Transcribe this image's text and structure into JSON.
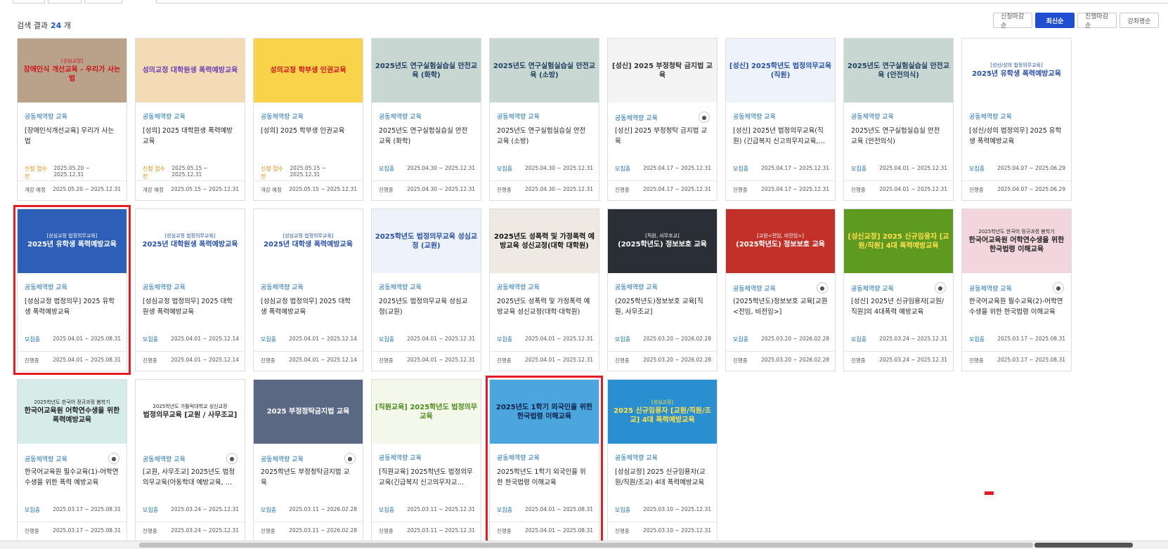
{
  "results": {
    "label": "검색 결과",
    "count": "24",
    "unit": "개"
  },
  "sort_buttons": [
    {
      "label": "신청마감순",
      "active": false
    },
    {
      "label": "최신순",
      "active": true
    },
    {
      "label": "진행마감순",
      "active": false
    },
    {
      "label": "강좌명순",
      "active": false
    }
  ],
  "cards": [
    {
      "thumb": "장애인식 개선교육 - 우리가 사는 법",
      "thumb_sub": "[성심교정]",
      "bg": "#b9a28a",
      "fg": "#d0141c",
      "category": "공동체역량 교육",
      "title": "[장애인식개선교육] 우리가 사는 법",
      "status": "신청 접수 전",
      "status_type": "pending",
      "apply_dates": "2025.05.20 ~ 2025.12.31",
      "progress": "개강 예정",
      "course_dates": "2025.05.20 ~ 2025.12.31",
      "lock": false,
      "highlight": false
    },
    {
      "thumb": "성의교정 대학원생 폭력예방교육",
      "thumb_sub": "",
      "bg": "#f3dcb5",
      "fg": "#6b3fb5",
      "category": "공동체역량 교육",
      "title": "[성의] 2025 대학원생 폭력예방 교육",
      "status": "신청 접수 전",
      "status_type": "pending",
      "apply_dates": "2025.05.15 ~ 2025.12.31",
      "progress": "개강 예정",
      "course_dates": "2025.05.15 ~ 2025.12.31",
      "lock": false,
      "highlight": false
    },
    {
      "thumb": "성의교정 학부생 인권교육",
      "thumb_sub": "",
      "bg": "#f9d34a",
      "fg": "#d0141c",
      "category": "공동체역량 교육",
      "title": "[성의] 2025 학부생 인권교육",
      "status": "신청 접수 전",
      "status_type": "pending",
      "apply_dates": "2025.05.15 ~ 2025.12.31",
      "progress": "개강 예정",
      "course_dates": "2025.05.15 ~ 2025.12.31",
      "lock": false,
      "highlight": false
    },
    {
      "thumb": "2025년도 연구실험실습실 안전교육 (화학)",
      "thumb_sub": "",
      "bg": "#c9d7d3",
      "fg": "#1e3f5f",
      "category": "공동체역량 교육",
      "title": "2025년도 연구실험실습실 안전교육 (화학)",
      "status": "모집중",
      "status_type": "open",
      "apply_dates": "2025.04.30 ~ 2025.12.31",
      "progress": "진행중",
      "course_dates": "2025.04.30 ~ 2025.12.31",
      "lock": false,
      "highlight": false
    },
    {
      "thumb": "2025년도 연구실험실습실 안전교육 (소방)",
      "thumb_sub": "",
      "bg": "#c9d7d3",
      "fg": "#1e3f5f",
      "category": "공동체역량 교육",
      "title": "2025년도 연구실험실습실 안전교육 (소방)",
      "status": "모집중",
      "status_type": "open",
      "apply_dates": "2025.04.30 ~ 2025.12.31",
      "progress": "진행중",
      "course_dates": "2025.04.30 ~ 2025.12.31",
      "lock": false,
      "highlight": false
    },
    {
      "thumb": "[성신] 2025 부정청탁 금지법 교육",
      "thumb_sub": "",
      "bg": "#f4f4f4",
      "fg": "#333333",
      "category": "공동체역량 교육",
      "title": "[성신] 2025 부정청탁 금지법 교육",
      "status": "모집중",
      "status_type": "open",
      "apply_dates": "2025.04.17 ~ 2025.12.31",
      "progress": "진행중",
      "course_dates": "2025.04.17 ~ 2025.12.31",
      "lock": true,
      "highlight": false
    },
    {
      "thumb": "[성신] 2025학년도 법정의무교육(직원)",
      "thumb_sub": "",
      "bg": "#eef2fa",
      "fg": "#2850a8",
      "category": "공동체역량 교육",
      "title": "[성신] 2025년 법정의무교육(직원) (긴급복지 신고의무자교육,…",
      "status": "모집중",
      "status_type": "open",
      "apply_dates": "2025.04.17 ~ 2025.12.31",
      "progress": "진행중",
      "course_dates": "2025.04.17 ~ 2025.12.31",
      "lock": false,
      "highlight": false
    },
    {
      "thumb": "2025년도 연구실험실습실 안전교육 (안전의식)",
      "thumb_sub": "",
      "bg": "#c9d7d3",
      "fg": "#1e3f5f",
      "category": "공동체역량 교육",
      "title": "2025년도 연구실험실습실 안전교육 (안전의식)",
      "status": "모집중",
      "status_type": "open",
      "apply_dates": "2025.04.01 ~ 2025.12.31",
      "progress": "진행중",
      "course_dates": "2025.04.01 ~ 2025.12.31",
      "lock": false,
      "highlight": false
    },
    {
      "thumb": "2025년 유학생 폭력예방교육",
      "thumb_sub": "[성신/성의 법정의무교육]",
      "bg": "#ffffff",
      "fg": "#2850a8",
      "category": "공동체역량 교육",
      "title": "[성신/성의 법정의무] 2025 유학생 폭력예방교육",
      "status": "모집중",
      "status_type": "open",
      "apply_dates": "2025.04.07 ~ 2025.06.29",
      "progress": "진행중",
      "course_dates": "2025.04.07 ~ 2025.06.29",
      "lock": false,
      "highlight": false
    },
    {
      "thumb": "2025년 유학생 폭력예방교육",
      "thumb_sub": "[성심교정 법정의무교육]",
      "bg": "#2e5fb8",
      "fg": "#ffffff",
      "category": "공동체역량 교육",
      "title": "[성심교정 법정의무] 2025 유학생 폭력예방교육",
      "status": "모집중",
      "status_type": "open",
      "apply_dates": "2025.04.01 ~ 2025.08.31",
      "progress": "진행중",
      "course_dates": "2025.04.01 ~ 2025.08.31",
      "lock": false,
      "highlight": true
    },
    {
      "thumb": "2025년 대학원생 폭력예방교육",
      "thumb_sub": "[성심교정 법정의무교육]",
      "bg": "#ffffff",
      "fg": "#2850a8",
      "category": "공동체역량 교육",
      "title": "[성심교정 법정의무] 2025 대학원생 폭력예방교육",
      "status": "모집중",
      "status_type": "open",
      "apply_dates": "2025.04.01 ~ 2025.12.14",
      "progress": "진행중",
      "course_dates": "2025.04.01 ~ 2025.12.14",
      "lock": false,
      "highlight": false
    },
    {
      "thumb": "2025년 대학생 폭력예방교육",
      "thumb_sub": "[성심교정 법정의무교육]",
      "bg": "#ffffff",
      "fg": "#2850a8",
      "category": "공동체역량 교육",
      "title": "[성심교정 법정의무] 2025 대학생 폭력예방교육",
      "status": "모집중",
      "status_type": "open",
      "apply_dates": "2025.04.01 ~ 2025.12.14",
      "progress": "진행중",
      "course_dates": "2025.04.01 ~ 2025.12.14",
      "lock": false,
      "highlight": false
    },
    {
      "thumb": "2025학년도 법정의무교육 성심교정 (교원)",
      "thumb_sub": "",
      "bg": "#eef2fa",
      "fg": "#2850a8",
      "category": "공동체역량 교육",
      "title": "2025년도 법정의무교육 성심교정(교원)",
      "status": "모집중",
      "status_type": "open",
      "apply_dates": "2025.04.01 ~ 2025.12.31",
      "progress": "진행중",
      "course_dates": "2025.04.01 ~ 2025.12.31",
      "lock": false,
      "highlight": false
    },
    {
      "thumb": "2025년도 성폭력 및 가정폭력 예방교육 성신교정(대학 대학원)",
      "thumb_sub": "",
      "bg": "#eeeae2",
      "fg": "#111111",
      "category": "공동체역량 교육",
      "title": "2025년도 성폭력 및 가정폭력 예방교육 성신교정(대학·대학원)",
      "status": "모집중",
      "status_type": "open",
      "apply_dates": "2025.04.01 ~ 2025.12.31",
      "progress": "진행중",
      "course_dates": "2025.04.01 ~ 2025.12.31",
      "lock": false,
      "highlight": false
    },
    {
      "thumb": "(2025학년도) 정보보호 교육",
      "thumb_sub": "[직원, 사무조교]",
      "bg": "#2a2f35",
      "fg": "#ffffff",
      "category": "공동체역량 교육",
      "title": "(2025학년도)정보보호 교육[직원, 사무조교]",
      "status": "모집중",
      "status_type": "open",
      "apply_dates": "2025.03.20 ~ 2026.02.28",
      "progress": "진행중",
      "course_dates": "2025.03.20 ~ 2026.02.28",
      "lock": false,
      "highlight": false
    },
    {
      "thumb": "(2025학년도) 정보보호 교육",
      "thumb_sub": "[교원<전임, 비전임>]",
      "bg": "#c2302a",
      "fg": "#ffffff",
      "category": "공동체역량 교육",
      "title": "(2025학년도)정보보호 교육[교원<전임, 비전임>]",
      "status": "모집중",
      "status_type": "open",
      "apply_dates": "2025.03.20 ~ 2026.02.28",
      "progress": "진행중",
      "course_dates": "2025.03.20 ~ 2026.02.28",
      "lock": true,
      "highlight": false
    },
    {
      "thumb": "[성신교정] 2025 신규임용자 [교원/직원] 4대 폭력예방교육",
      "thumb_sub": "",
      "bg": "#5e9a1f",
      "fg": "#ffe14d",
      "category": "공동체역량 교육",
      "title": "[성신] 2025년 신규임용자[교원/직원]의 4대폭력 예방교육",
      "status": "모집중",
      "status_type": "open",
      "apply_dates": "2025.03.24 ~ 2025.12.31",
      "progress": "진행중",
      "course_dates": "2025.03.24 ~ 2025.12.31",
      "lock": true,
      "highlight": false
    },
    {
      "thumb": "한국어교육원 어학연수생을 위한 한국법령 이해교육",
      "thumb_sub": "2025학년도 한국어 정규과정 봄학기",
      "bg": "#f2d6de",
      "fg": "#222222",
      "category": "공동체역량 교육",
      "title": "한국어교육원 필수교육(2)-어학연수생을 위한 한국법령 이해교육",
      "status": "모집중",
      "status_type": "open",
      "apply_dates": "2025.03.17 ~ 2025.08.31",
      "progress": "진행중",
      "course_dates": "2025.03.17 ~ 2025.08.31",
      "lock": true,
      "highlight": false
    },
    {
      "thumb": "한국어교육원 어학연수생을 위한 폭력예방교육",
      "thumb_sub": "2025학년도 한국어 정규과정 봄학기",
      "bg": "#d6ece8",
      "fg": "#222222",
      "category": "공동체역량 교육",
      "title": "한국어교육원 필수교육(1)-어학연수생을 위한 폭력 예방교육",
      "status": "모집중",
      "status_type": "open",
      "apply_dates": "2025.03.17 ~ 2025.08.31",
      "progress": "진행중",
      "course_dates": "2025.03.17 ~ 2025.08.31",
      "lock": true,
      "highlight": false
    },
    {
      "thumb": "법정의무교육 [교원 / 사무조교]",
      "thumb_sub": "2025학년도 가톨릭대학교 성신교정",
      "bg": "#ffffff",
      "fg": "#222222",
      "category": "공동체역량 교육",
      "title": "[교원, 사무조교] 2025년도 법정의무교육(아동학대 예방교육, …",
      "status": "모집중",
      "status_type": "open",
      "apply_dates": "2025.03.24 ~ 2025.12.31",
      "progress": "진행중",
      "course_dates": "2025.03.24 ~ 2025.12.31",
      "lock": true,
      "highlight": false
    },
    {
      "thumb": "2025 부정청탁금지법 교육",
      "thumb_sub": "",
      "bg": "#5b6884",
      "fg": "#ffffff",
      "category": "공동체역량 교육",
      "title": "2025학년도 부정청탁금지법 교육",
      "status": "모집중",
      "status_type": "open",
      "apply_dates": "2025.03.11 ~ 2026.02.28",
      "progress": "진행중",
      "course_dates": "2025.03.11 ~ 2026.02.28",
      "lock": true,
      "highlight": false
    },
    {
      "thumb": "[직원교육] 2025학년도 법정의무교육",
      "thumb_sub": "",
      "bg": "#f3f8ea",
      "fg": "#4c8a1a",
      "category": "공동체역량 교육",
      "title": "[직원교육] 2025학년도 법정의무교육(긴급복지 신고의무자교…",
      "status": "모집중",
      "status_type": "open",
      "apply_dates": "2025.03.11 ~ 2025.12.31",
      "progress": "진행중",
      "course_dates": "2025.03.11 ~ 2025.12.31",
      "lock": false,
      "highlight": false
    },
    {
      "thumb": "2025년도 1학기 외국인을 위한 한국법령 이해교육",
      "thumb_sub": "",
      "bg": "#4aa6dd",
      "fg": "#0c1f4a",
      "category": "공동체역량 교육",
      "title": "2025학년도 1학기 외국인을 위한 한국법령 이해교육",
      "status": "모집중",
      "status_type": "open",
      "apply_dates": "2025.04.01 ~ 2025.08.31",
      "progress": "진행중",
      "course_dates": "2025.04.01 ~ 2025.08.31",
      "lock": false,
      "highlight": true
    },
    {
      "thumb": "2025 신규임용자 [교원/직원/조교] 4대 폭력예방교육",
      "thumb_sub": "[성심교정]",
      "bg": "#2a8fd0",
      "fg": "#ffe14d",
      "category": "공동체역량 교육",
      "title": "[성심교정] 2025 신규임용자(교원/직원/조교) 4대 폭력예방교육",
      "status": "모집중",
      "status_type": "open",
      "apply_dates": "2025.03.10 ~ 2025.12.31",
      "progress": "진행중",
      "course_dates": "2025.03.10 ~ 2025.12.31",
      "lock": false,
      "highlight": false
    }
  ]
}
